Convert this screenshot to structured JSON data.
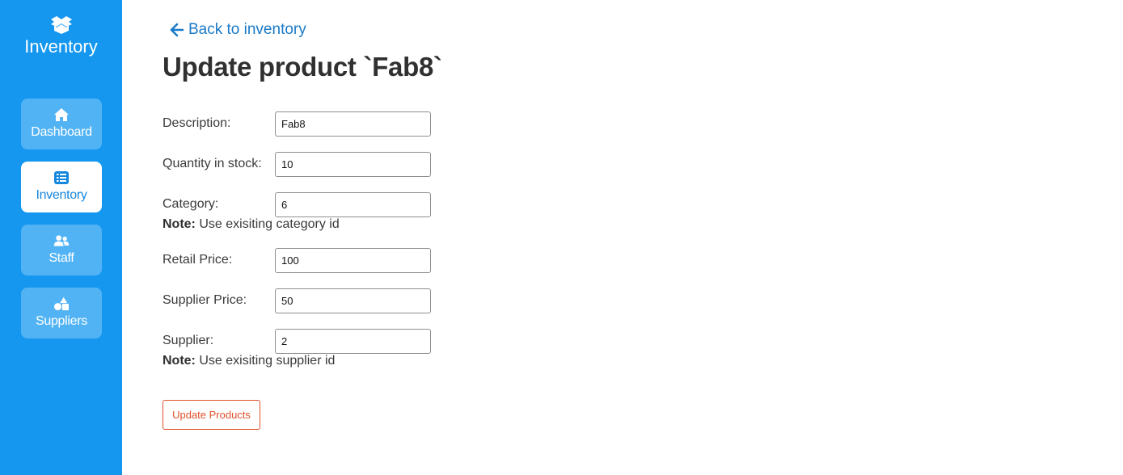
{
  "sidebar": {
    "brand": {
      "icon": "box-open-icon",
      "label": "Inventory"
    },
    "items": [
      {
        "label": "Dashboard",
        "icon": "home-icon",
        "active": false
      },
      {
        "label": "Inventory",
        "icon": "list-icon",
        "active": true
      },
      {
        "label": "Staff",
        "icon": "users-icon",
        "active": false
      },
      {
        "label": "Suppliers",
        "icon": "shapes-icon",
        "active": false
      }
    ]
  },
  "back_link": {
    "label": "Back to inventory",
    "icon": "arrow-left-icon"
  },
  "page_title": "Update product `Fab8`",
  "form": {
    "description": {
      "label": "Description:",
      "value": "Fab8"
    },
    "quantity": {
      "label": "Quantity in stock:",
      "value": "10"
    },
    "category": {
      "label": "Category:",
      "value": "6",
      "note_bold": "Note:",
      "note_text": " Use exisiting category id"
    },
    "retail_price": {
      "label": "Retail Price:",
      "value": "100"
    },
    "supplier_price": {
      "label": "Supplier Price:",
      "value": "50"
    },
    "supplier": {
      "label": "Supplier:",
      "value": "2",
      "note_bold": "Note:",
      "note_text": " Use exisiting supplier id"
    },
    "submit_label": "Update Products"
  },
  "colors": {
    "sidebar_bg": "#1597f0",
    "nav_item_bg": "#52b3f4",
    "link": "#1a7ac8",
    "button_accent": "#e0512b"
  }
}
